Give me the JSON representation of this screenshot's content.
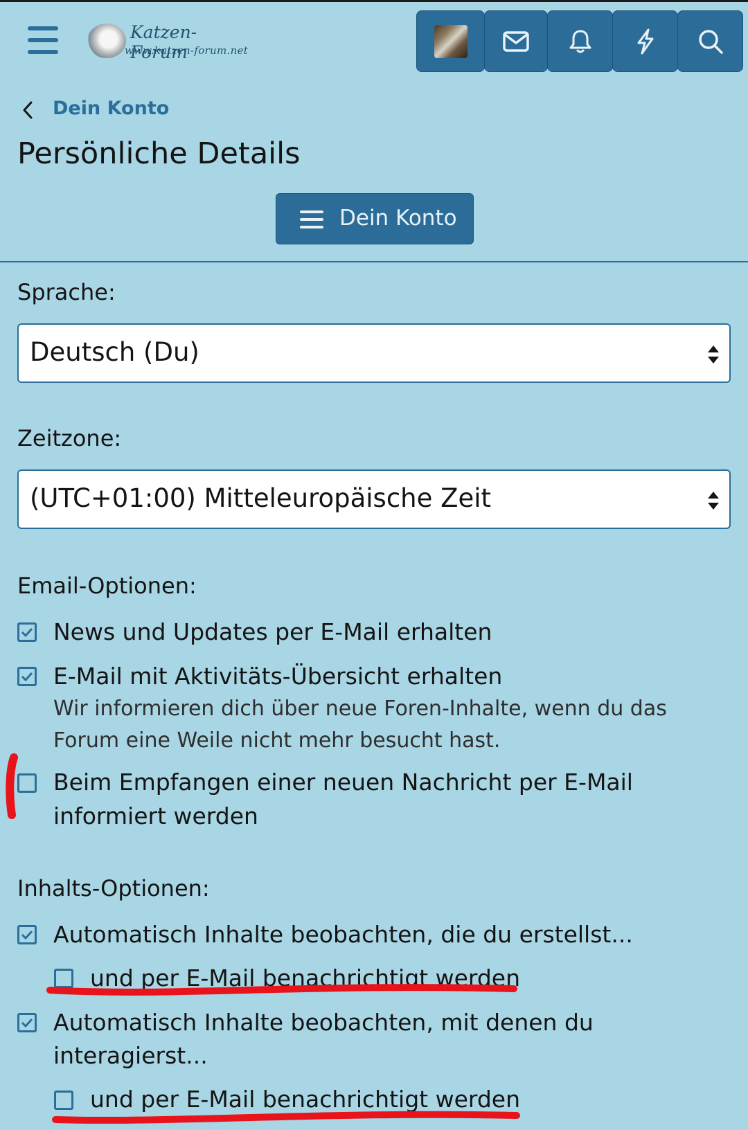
{
  "header": {
    "logo_title": "Katzen-Forum",
    "logo_subtitle": "www.katzen-forum.net",
    "icons": [
      "menu-icon",
      "avatar",
      "envelope-icon",
      "bell-icon",
      "bolt-icon",
      "search-icon"
    ]
  },
  "breadcrumb": {
    "label": "Dein Konto"
  },
  "page_title": "Persönliche Details",
  "account_menu_button": {
    "label": "Dein Konto"
  },
  "form": {
    "language": {
      "label": "Sprache:",
      "value": "Deutsch (Du)"
    },
    "timezone": {
      "label": "Zeitzone:",
      "value": "(UTC+01:00) Mitteleuropäische Zeit"
    },
    "email_options": {
      "label": "Email-Optionen:",
      "items": [
        {
          "text": "News und Updates per E-Mail erhalten",
          "checked": true
        },
        {
          "text": "E-Mail mit Aktivitäts-Übersicht erhalten",
          "hint_line1": "Wir informieren dich über neue Foren-Inhalte, wenn du das",
          "hint_line2": "Forum eine Weile nicht mehr besucht hast.",
          "checked": true
        },
        {
          "text_line1": "Beim Empfangen einer neuen Nachricht per E-Mail",
          "text_line2": "informiert werden",
          "checked": false
        }
      ]
    },
    "content_options": {
      "label": "Inhalts-Optionen:",
      "items": [
        {
          "text": "Automatisch Inhalte beobachten, die du erstellst...",
          "checked": true
        },
        {
          "text": "und per E-Mail benachrichtigt werden",
          "checked": false
        },
        {
          "text_line1": "Automatisch Inhalte beobachten, mit denen du",
          "text_line2": "interagierst...",
          "checked": true
        },
        {
          "text": "und per E-Mail benachrichtigt werden",
          "checked": false
        }
      ]
    }
  },
  "colors": {
    "background": "#a9d6e5",
    "accent": "#2a6f9a",
    "annotation": "#e8141c"
  }
}
